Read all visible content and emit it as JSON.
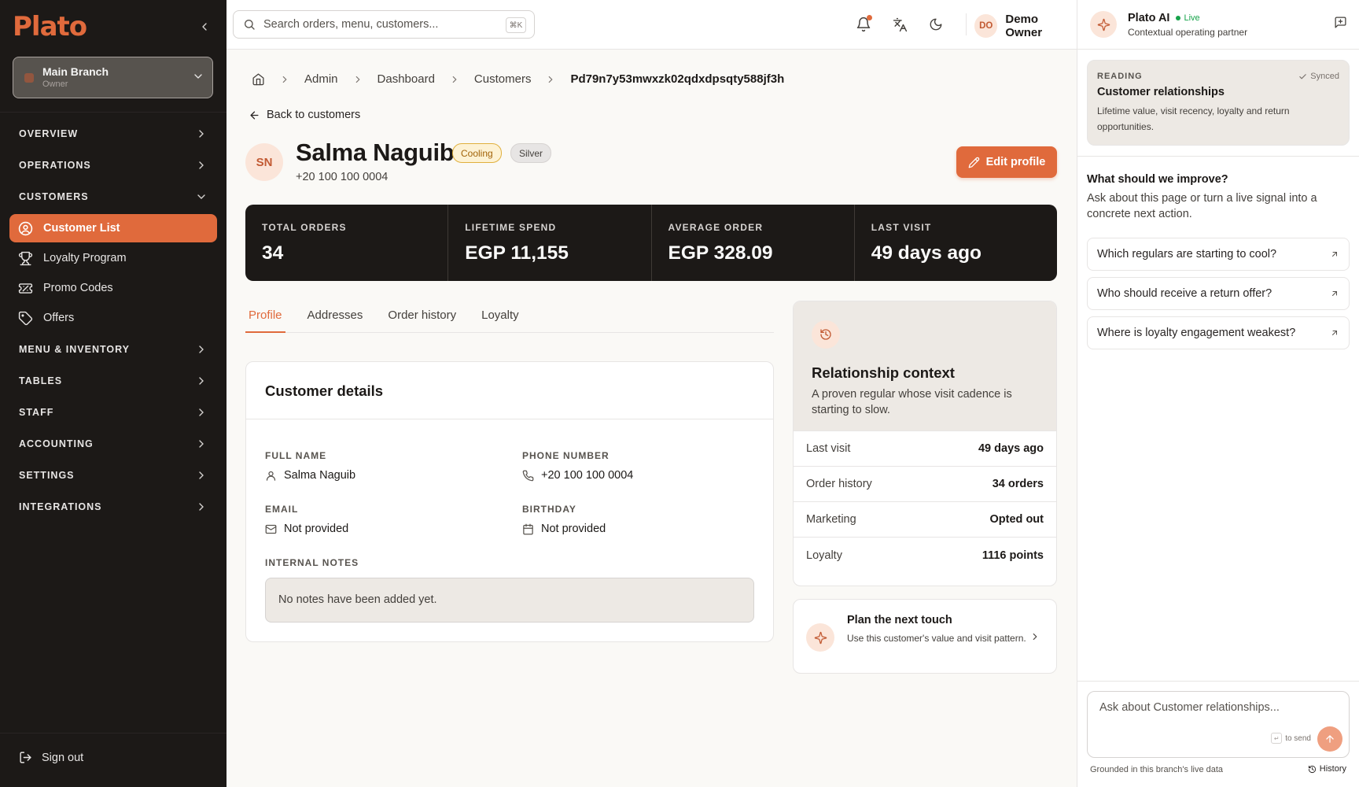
{
  "sidebar": {
    "logo": "Plato",
    "branch": {
      "name": "Main Branch",
      "role": "Owner"
    },
    "sections": [
      {
        "label": "OVERVIEW"
      },
      {
        "label": "OPERATIONS"
      },
      {
        "label": "CUSTOMERS"
      },
      {
        "label": "MENU & INVENTORY"
      },
      {
        "label": "TABLES"
      },
      {
        "label": "STAFF"
      },
      {
        "label": "ACCOUNTING"
      },
      {
        "label": "SETTINGS"
      },
      {
        "label": "INTEGRATIONS"
      }
    ],
    "customer_items": [
      {
        "label": "Customer List",
        "icon": "user-circle-icon",
        "active": true
      },
      {
        "label": "Loyalty Program",
        "icon": "trophy-icon"
      },
      {
        "label": "Promo Codes",
        "icon": "ticket-icon"
      },
      {
        "label": "Offers",
        "icon": "tag-icon"
      }
    ],
    "sign_out": "Sign out"
  },
  "topbar": {
    "search_placeholder": "Search orders, menu, customers...",
    "search_shortcut": "⌘K",
    "user": {
      "initials": "DO",
      "name": "Demo Owner"
    }
  },
  "breadcrumb": [
    "Admin",
    "Dashboard",
    "Customers",
    "Pd79n7y53mwxzk02qdxdpsqty588jf3h"
  ],
  "back_label": "Back to customers",
  "customer": {
    "initials": "SN",
    "name": "Salma Naguib",
    "status_badge": "Cooling",
    "tier_badge": "Silver",
    "phone": "+20 100 100 0004"
  },
  "edit_profile_label": "Edit profile",
  "stats": [
    {
      "label": "TOTAL ORDERS",
      "value": "34"
    },
    {
      "label": "LIFETIME SPEND",
      "value": "EGP 11,155"
    },
    {
      "label": "AVERAGE ORDER",
      "value": "EGP 328.09"
    },
    {
      "label": "LAST VISIT",
      "value": "49 days ago"
    }
  ],
  "tabs": [
    "Profile",
    "Addresses",
    "Order history",
    "Loyalty"
  ],
  "details": {
    "title": "Customer details",
    "full_name_label": "FULL NAME",
    "full_name": "Salma Naguib",
    "phone_label": "PHONE NUMBER",
    "phone": "+20 100 100 0004",
    "email_label": "EMAIL",
    "email": "Not provided",
    "birthday_label": "BIRTHDAY",
    "birthday": "Not provided",
    "notes_label": "INTERNAL NOTES",
    "notes": "No notes have been added yet."
  },
  "relationship": {
    "title": "Relationship context",
    "subtitle": "A proven regular whose visit cadence is starting to slow.",
    "rows": [
      {
        "k": "Last visit",
        "v": "49 days ago"
      },
      {
        "k": "Order history",
        "v": "34 orders"
      },
      {
        "k": "Marketing",
        "v": "Opted out"
      },
      {
        "k": "Loyalty",
        "v": "1116 points"
      }
    ]
  },
  "plan": {
    "title": "Plan the next touch",
    "subtitle": "Use this customer's value and visit pattern."
  },
  "ai": {
    "name": "Plato AI",
    "live": "Live",
    "subtitle": "Contextual operating partner",
    "reading_label": "READING",
    "synced": "Synced",
    "reading_title": "Customer relationships",
    "reading_sub": "Lifetime value, visit recency, loyalty and return opportunities.",
    "improve_title": "What should we improve?",
    "improve_sub": "Ask about this page or turn a live signal into a concrete next action.",
    "questions": [
      "Which regulars are starting to cool?",
      "Who should receive a return offer?",
      "Where is loyalty engagement weakest?"
    ],
    "composer_placeholder": "Ask about Customer relationships...",
    "enter_key": "↵",
    "to_send": "to send",
    "grounded": "Grounded in this branch's live data",
    "history": "History"
  },
  "colors": {
    "accent": "#e06a3c",
    "sidebar_bg": "#1c1917",
    "live": "#16a34a",
    "cooling": "#fdf2d4"
  }
}
